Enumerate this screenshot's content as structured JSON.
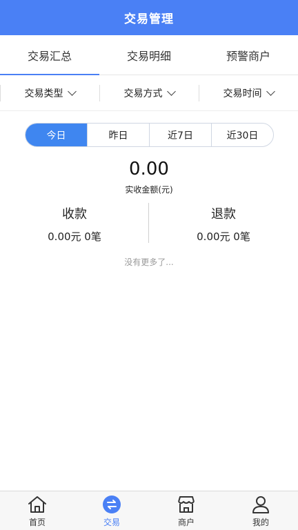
{
  "header": {
    "title": "交易管理"
  },
  "tabs": [
    {
      "label": "交易汇总",
      "active": true
    },
    {
      "label": "交易明细",
      "active": false
    },
    {
      "label": "预警商户",
      "active": false
    }
  ],
  "filters": [
    {
      "label": "交易类型"
    },
    {
      "label": "交易方式"
    },
    {
      "label": "交易时间"
    }
  ],
  "segments": [
    {
      "label": "今日",
      "active": true
    },
    {
      "label": "昨日",
      "active": false
    },
    {
      "label": "近7日",
      "active": false
    },
    {
      "label": "近30日",
      "active": false
    }
  ],
  "summary": {
    "amount": "0.00",
    "amount_label": "实收金额(元)",
    "income": {
      "label": "收款",
      "value": "0.00元 0笔"
    },
    "refund": {
      "label": "退款",
      "value": "0.00元 0笔"
    }
  },
  "no_more": "没有更多了...",
  "bottom_nav": [
    {
      "label": "首页",
      "icon": "home-icon"
    },
    {
      "label": "交易",
      "icon": "exchange-icon",
      "active": true
    },
    {
      "label": "商户",
      "icon": "store-icon"
    },
    {
      "label": "我的",
      "icon": "user-icon"
    }
  ],
  "colors": {
    "accent": "#4a80f5",
    "segment_active": "#3f86f0"
  }
}
